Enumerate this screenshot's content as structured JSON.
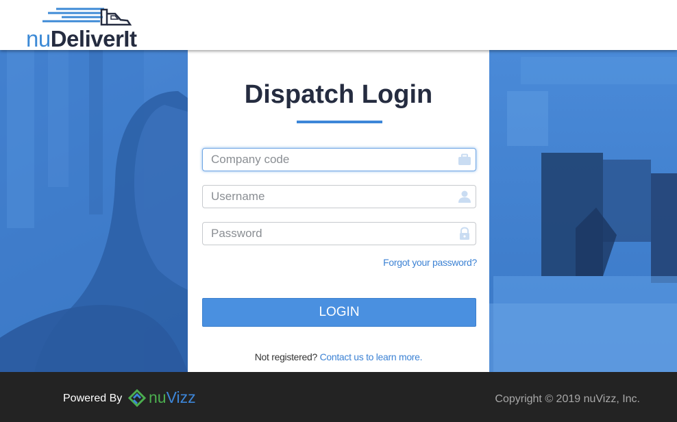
{
  "header": {
    "logo": {
      "prefix": "nu",
      "name": "DeliverIt"
    }
  },
  "login": {
    "title": "Dispatch Login",
    "company_code_placeholder": "Company code",
    "username_placeholder": "Username",
    "password_placeholder": "Password",
    "forgot_link": "Forgot your password?",
    "login_button": "LOGIN",
    "not_registered": "Not registered?",
    "contact_link": "Contact us to learn more."
  },
  "footer": {
    "powered_by": "Powered By",
    "brand_prefix": "nu",
    "brand_suffix": "Vizz",
    "copyright": "Copyright © 2019 nuVizz, Inc."
  },
  "colors": {
    "accent": "#4a90e0",
    "link": "#3c82d4",
    "title": "#252c40",
    "footer_bg": "#232323",
    "hero_blue": "#3a79c9"
  },
  "icons": {
    "company_code": "briefcase-icon",
    "username": "user-icon",
    "password": "lock-icon",
    "footer_brand": "nuvizz-logo-icon"
  }
}
